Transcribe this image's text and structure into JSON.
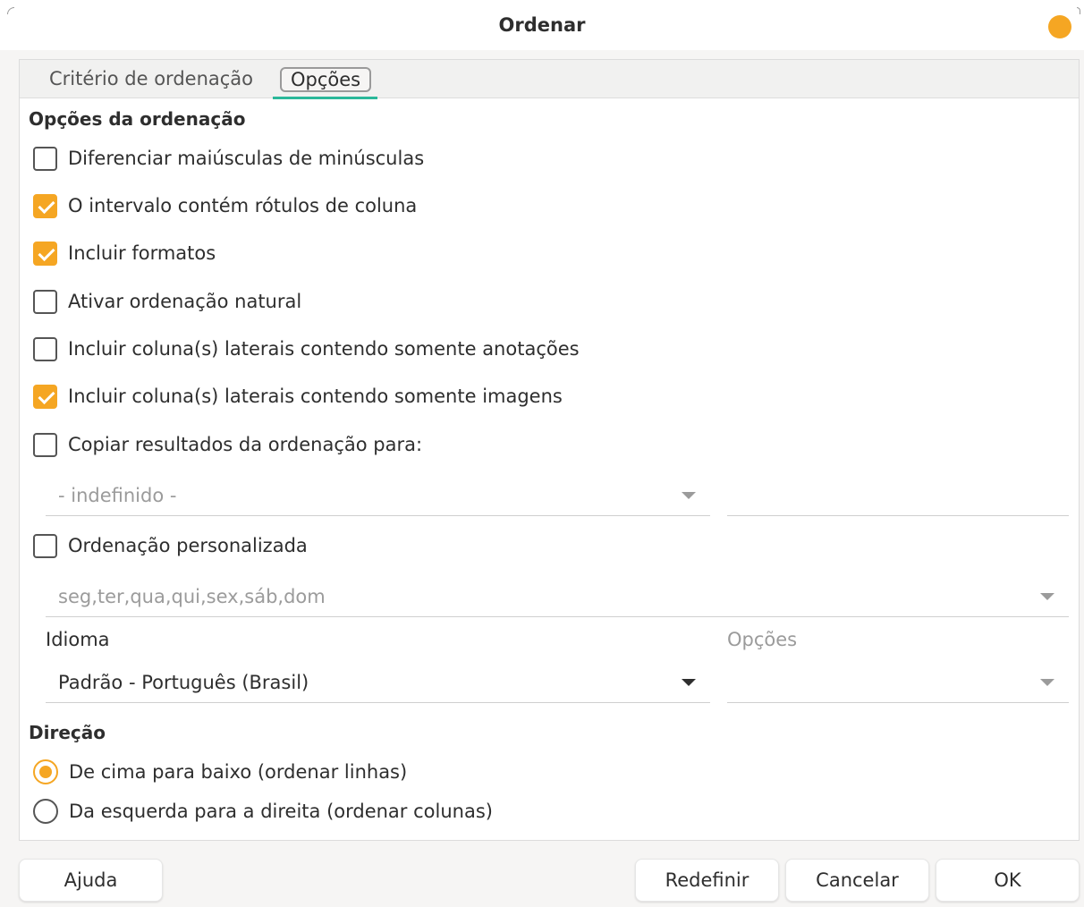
{
  "window": {
    "title": "Ordenar",
    "accent_color": "#f5a623"
  },
  "tabs": [
    {
      "label": "Critério de ordenação",
      "active": false
    },
    {
      "label": "Opções",
      "active": true
    }
  ],
  "sort_options": {
    "heading": "Opções da ordenação",
    "items": [
      {
        "label": "Diferenciar maiúsculas de minúsculas",
        "checked": false
      },
      {
        "label": "O intervalo contém rótulos de coluna",
        "checked": true
      },
      {
        "label": "Incluir formatos",
        "checked": true
      },
      {
        "label": "Ativar ordenação natural",
        "checked": false
      },
      {
        "label": "Incluir coluna(s) laterais contendo somente anotações",
        "checked": false
      },
      {
        "label": "Incluir coluna(s) laterais contendo somente imagens",
        "checked": true
      },
      {
        "label": "Copiar resultados da ordenação para:",
        "checked": false
      }
    ]
  },
  "copy_target": {
    "value": "- indefinido -",
    "text_value": ""
  },
  "custom_sort": {
    "label": "Ordenação personalizada",
    "checked": false,
    "value": "seg,ter,qua,qui,sex,sáb,dom"
  },
  "language": {
    "label": "Idioma",
    "value": "Padrão - Português (Brasil)",
    "options_label": "Opções",
    "options_value": ""
  },
  "direction": {
    "heading": "Direção",
    "options": [
      {
        "label": "De cima para baixo (ordenar linhas)",
        "selected": true
      },
      {
        "label": "Da esquerda para a direita (ordenar colunas)",
        "selected": false
      }
    ]
  },
  "buttons": {
    "help": "Ajuda",
    "reset": "Redefinir",
    "cancel": "Cancelar",
    "ok": "OK"
  }
}
